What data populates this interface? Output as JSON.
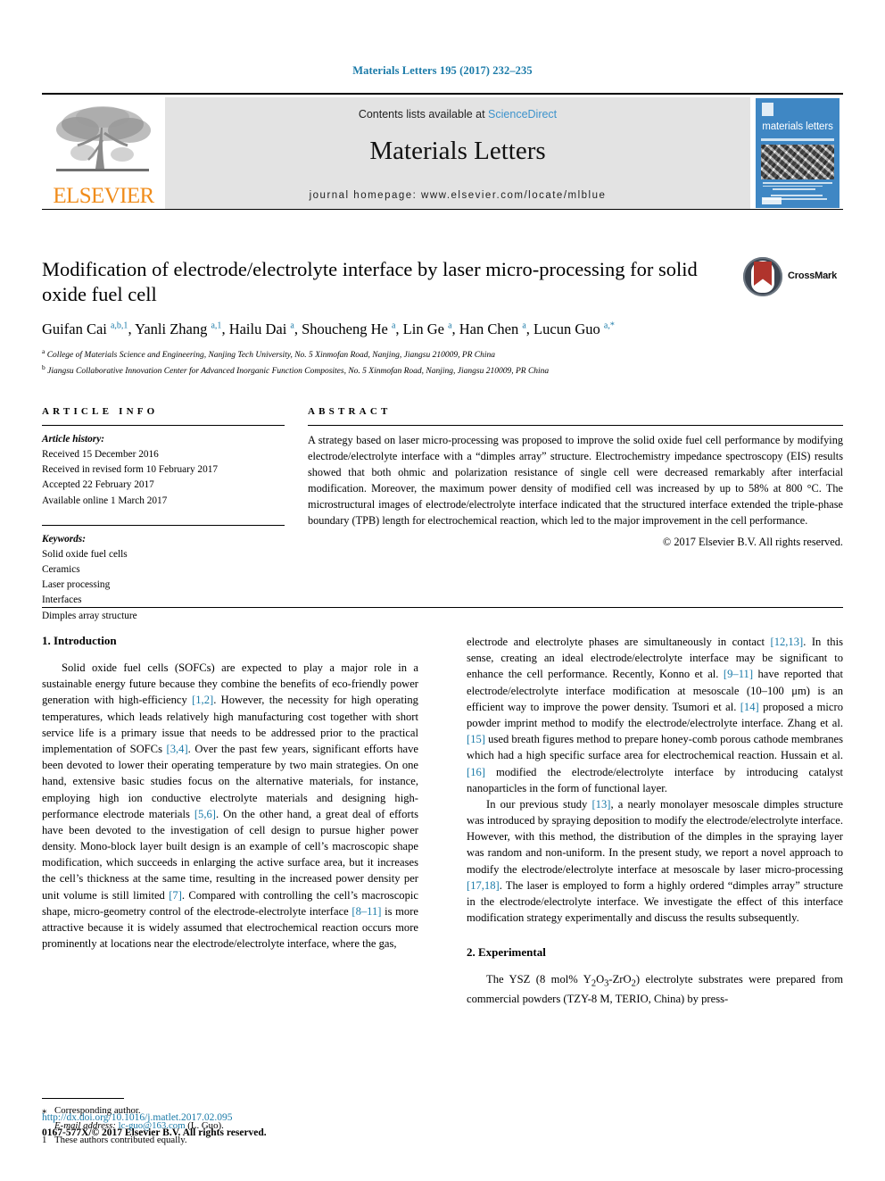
{
  "running_head": "Materials Letters 195 (2017) 232–235",
  "masthead": {
    "contents_prefix": "Contents lists available at ",
    "sciencedirect": "ScienceDirect",
    "journal_name": "Materials Letters",
    "homepage": "journal homepage: www.elsevier.com/locate/mlblue",
    "publisher_wordmark": "ELSEVIER",
    "cover_title": "materials letters",
    "link_color": "#3d93cc",
    "cover_color": "#3f87c4",
    "wordmark_color": "#f08c1b"
  },
  "article": {
    "title": "Modification of electrode/electrolyte interface by laser micro-processing for solid oxide fuel cell",
    "crossmark_label": "CrossMark",
    "authors_html": "Guifan Cai <sup>a,b,1</sup>, Yanli Zhang <sup>a,1</sup>, Hailu Dai <sup>a</sup>, Shoucheng He <sup>a</sup>, Lin Ge <sup>a</sup>, Han Chen <sup>a</sup>, Lucun Guo <sup>a,*</sup>",
    "affiliation_a": "College of Materials Science and Engineering, Nanjing Tech University, No. 5 Xinmofan Road, Nanjing, Jiangsu 210009, PR China",
    "affiliation_b": "Jiangsu Collaborative Innovation Center for Advanced Inorganic Function Composites, No. 5 Xinmofan Road, Nanjing, Jiangsu 210009, PR China"
  },
  "info": {
    "heading": "ARTICLE INFO",
    "history_label": "Article history:",
    "history": [
      "Received 15 December 2016",
      "Received in revised form 10 February 2017",
      "Accepted 22 February 2017",
      "Available online 1 March 2017"
    ],
    "keywords_label": "Keywords:",
    "keywords": [
      "Solid oxide fuel cells",
      "Ceramics",
      "Laser processing",
      "Interfaces",
      "Dimples array structure"
    ]
  },
  "abstract": {
    "heading": "ABSTRACT",
    "text": "A strategy based on laser micro-processing was proposed to improve the solid oxide fuel cell performance by modifying electrode/electrolyte interface with a “dimples array” structure. Electrochemistry impedance spectroscopy (EIS) results showed that both ohmic and polarization resistance of single cell were decreased remarkably after interfacial modification. Moreover, the maximum power density of modified cell was increased by up to 58% at 800 °C. The microstructural images of electrode/electrolyte interface indicated that the structured interface extended the triple-phase boundary (TPB) length for electrochemical reaction, which led to the major improvement in the cell performance.",
    "copyright": "© 2017 Elsevier B.V. All rights reserved."
  },
  "sections": {
    "introduction_heading": "1. Introduction",
    "experimental_heading": "2. Experimental"
  },
  "body": {
    "left_p1_a": "Solid oxide fuel cells (SOFCs) are expected to play a major role in a sustainable energy future because they combine the benefits of eco-friendly power generation with high-efficiency ",
    "left_cite_1": "[1,2]",
    "left_p1_b": ". However, the necessity for high operating temperatures, which leads relatively high manufacturing cost together with short service life is a primary issue that needs to be addressed prior to the practical implementation of SOFCs ",
    "left_cite_2": "[3,4]",
    "left_p1_c": ". Over the past few years, significant efforts have been devoted to lower their operating temperature by two main strategies. On one hand, extensive basic studies focus on the alternative materials, for instance, employing high ion conductive electrolyte materials and designing high-performance electrode materials ",
    "left_cite_3": "[5,6]",
    "left_p1_d": ". On the other hand, a great deal of efforts have been devoted to the investigation of cell design to pursue higher power density. Mono-block layer built design is an example of cell’s macroscopic shape modification, which succeeds in enlarging the active surface area, but it increases the cell’s thickness at the same time, resulting in the increased power density per unit volume is still limited ",
    "left_cite_4": "[7]",
    "left_p1_e": ". Compared with controlling the cell’s macroscopic shape, micro-geometry control of the electrode-electrolyte interface ",
    "left_cite_5": "[8–11]",
    "left_p1_f": " is more attractive because it is widely assumed that electrochemical reaction occurs more prominently at locations near the electrode/electrolyte interface, where the gas,",
    "right_p1_a": "electrode and electrolyte phases are simultaneously in contact ",
    "right_cite_1": "[12,13]",
    "right_p1_b": ". In this sense, creating an ideal electrode/electrolyte interface may be significant to enhance the cell performance. Recently, Konno et al. ",
    "right_cite_2": "[9–11]",
    "right_p1_c": " have reported that electrode/electrolyte interface modification at mesoscale (10–100 μm) is an efficient way to improve the power density. Tsumori et al. ",
    "right_cite_3": "[14]",
    "right_p1_d": " proposed a micro powder imprint method to modify the electrode/electrolyte interface. Zhang et al. ",
    "right_cite_4": "[15]",
    "right_p1_e": " used breath figures method to prepare honey-comb porous cathode membranes which had a high specific surface area for electrochemical reaction. Hussain et al. ",
    "right_cite_5": "[16]",
    "right_p1_f": " modified the electrode/electrolyte interface by introducing catalyst nanoparticles in the form of functional layer.",
    "right_p2_a": "In our previous study ",
    "right_cite_6": "[13]",
    "right_p2_b": ", a nearly monolayer mesoscale dimples structure was introduced by spraying deposition to modify the electrode/electrolyte interface. However, with this method, the distribution of the dimples in the spraying layer was random and non-uniform. In the present study, we report a novel approach to modify the electrode/electrolyte interface at mesoscale by laser micro-processing ",
    "right_cite_7": "[17,18]",
    "right_p2_c": ". The laser is employed to form a highly ordered “dimples array” structure in the electrode/electrolyte interface. We investigate the effect of this interface modification strategy experimentally and discuss the results subsequently.",
    "right_p3_html": "The YSZ (8 mol% Y<sub>2</sub>O<sub>3</sub>-ZrO<sub>2</sub>) electrolyte substrates were prepared from commercial powders (TZY-8 M, TERIO, China) by press-"
  },
  "footnotes": {
    "corresponding_mark": "⁎",
    "corresponding_text": "Corresponding author.",
    "email_label": "E-mail address:",
    "email": "lc-guo@163.com",
    "email_suffix": "(L. Guo).",
    "equal_mark": "1",
    "equal_text": "These authors contributed equally.",
    "doi": "http://dx.doi.org/10.1016/j.matlet.2017.02.095",
    "issn": "0167-577X/© 2017 Elsevier B.V. All rights reserved."
  }
}
